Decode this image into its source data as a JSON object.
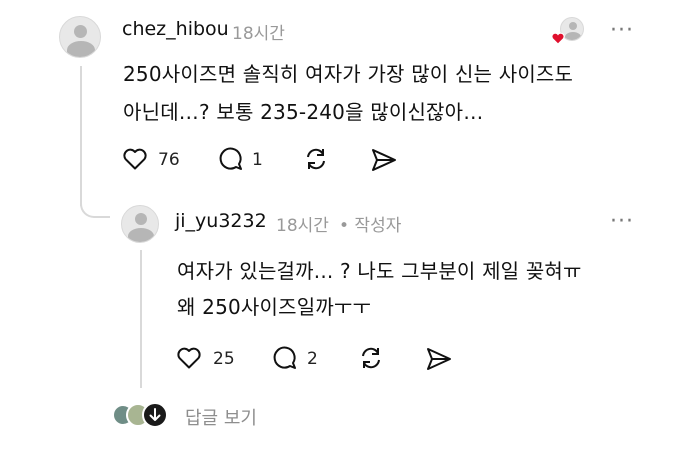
{
  "post": {
    "username": "chez_hibou",
    "time": "18시간",
    "lines": [
      "250사이즈면 솔직히 여자가 가장 많이 신는 사이즈도",
      "아닌데…? 보통 235-240을 많이신잖아…"
    ],
    "likes": "76",
    "comments": "1"
  },
  "reply": {
    "username": "ji_yu3232",
    "time": "18시간",
    "author_tag": "• 작성자",
    "lines": [
      "여자가 있는걸까... ? 나도 그부분이 제일 꽂혀ㅠ",
      "왜 250사이즈일까ㅜㅜ"
    ],
    "likes": "25",
    "comments": "2"
  },
  "footer": {
    "view_replies": "답글 보기"
  },
  "more_label": "···",
  "colors": {
    "heart_badge": "#e0102d",
    "icon": "#111111",
    "muted": "#999999"
  }
}
